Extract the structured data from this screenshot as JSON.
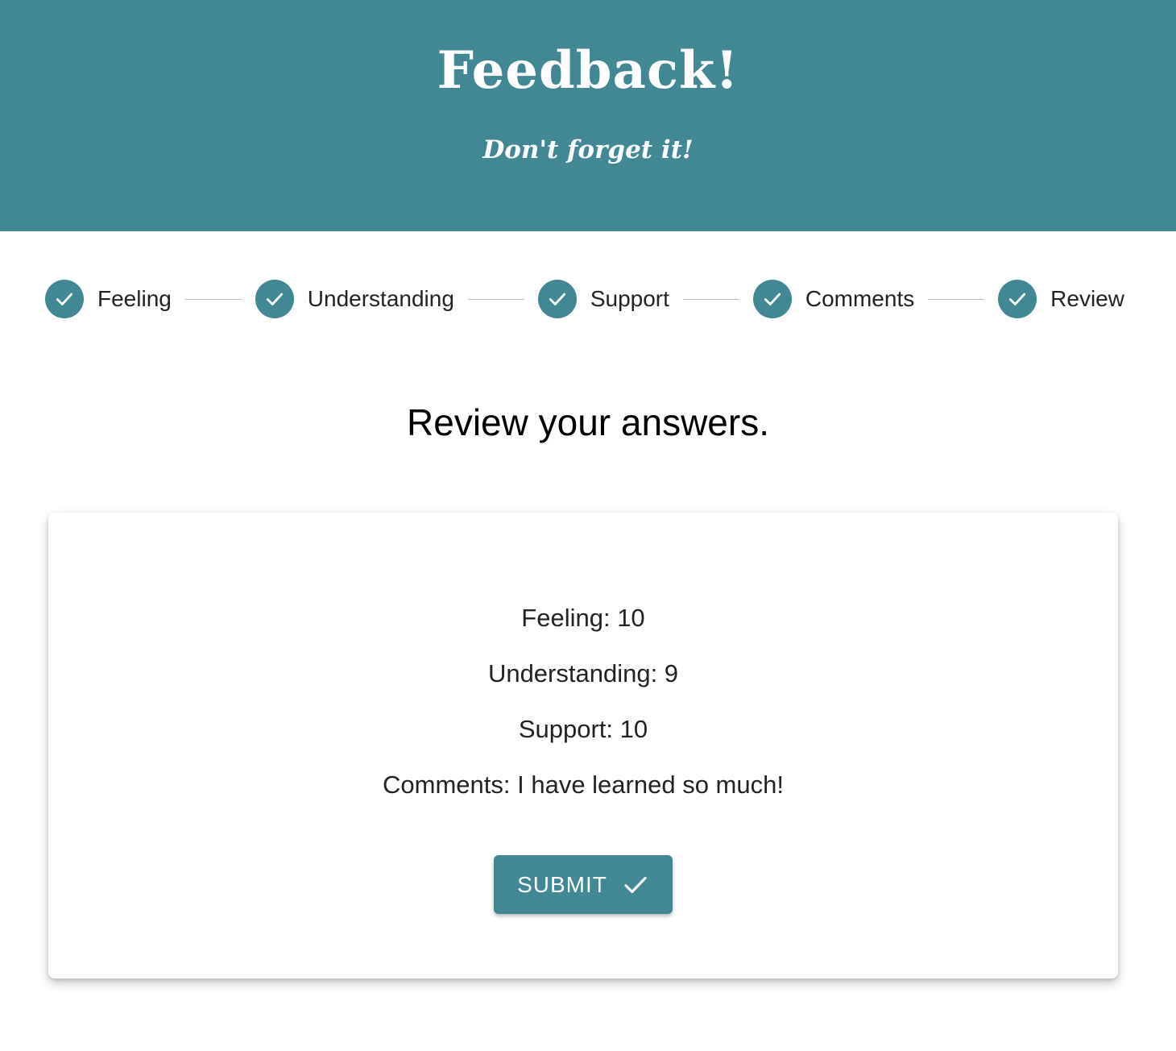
{
  "header": {
    "title": "Feedback!",
    "subtitle": "Don't forget it!"
  },
  "stepper": {
    "steps": [
      {
        "label": "Feeling",
        "status": "completed",
        "icon": "check-circle-icon"
      },
      {
        "label": "Understanding",
        "status": "completed",
        "icon": "check-circle-icon"
      },
      {
        "label": "Support",
        "status": "completed",
        "icon": "check-circle-icon"
      },
      {
        "label": "Comments",
        "status": "completed",
        "icon": "check-circle-icon"
      },
      {
        "label": "Review",
        "status": "completed",
        "icon": "check-circle-icon"
      }
    ]
  },
  "main": {
    "title": "Review your answers.",
    "answers": {
      "feeling": "Feeling: 10",
      "understanding": "Understanding: 9",
      "support": "Support: 10",
      "comments": "Comments: I have learned so much!"
    },
    "submit_label": "SUBMIT",
    "submit_icon": "check-icon"
  },
  "colors": {
    "primary": "#418794",
    "header_text": "#ffffff",
    "body_text": "#222222",
    "connector": "#bdbdbd"
  }
}
